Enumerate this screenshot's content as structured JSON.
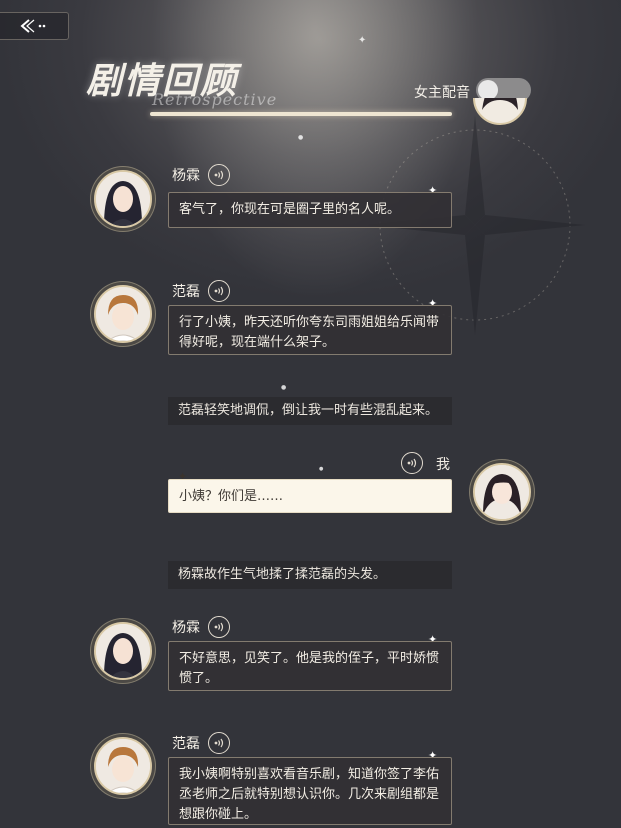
{
  "header": {
    "back_label": "back",
    "title": "剧情回顾",
    "subtitle": "Retrospective",
    "voice_toggle_label": "女主配音",
    "voice_toggle_on": false
  },
  "messages": [
    {
      "speaker": "杨霖",
      "text": "客气了，你现在可是圈子里的名人呢。"
    },
    {
      "speaker": "范磊",
      "text": "行了小姨，昨天还听你夸东司雨姐姐给乐闻带得好呢，现在端什么架子。"
    },
    {
      "narration": "范磊轻笑地调侃，倒让我一时有些混乱起来。"
    },
    {
      "speaker": "我",
      "text": "小姨？你们是……"
    },
    {
      "narration": "杨霖故作生气地揉了揉范磊的头发。"
    },
    {
      "speaker": "杨霖",
      "text": "不好意思，见笑了。他是我的侄子，平时娇惯惯了。"
    },
    {
      "speaker": "范磊",
      "text": "我小姨啊特别喜欢看音乐剧，知道你签了李佑丞老师之后就特别想认识你。几次来剧组都是想跟你碰上。"
    }
  ],
  "colors": {
    "bubble_dark": "#323034",
    "bubble_mine": "#fbf6ea",
    "accent_gold": "#d9c9a6"
  }
}
